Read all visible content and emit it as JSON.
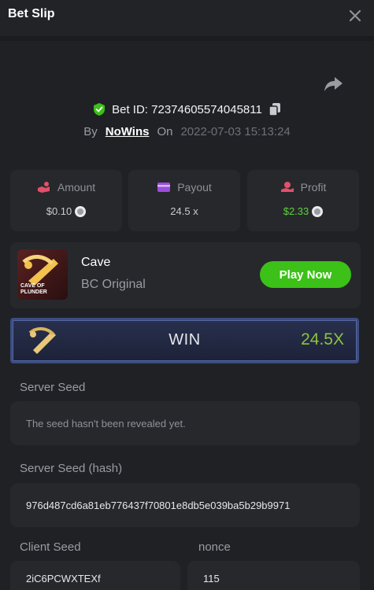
{
  "header": {
    "title": "Bet Slip"
  },
  "bet": {
    "id_text": "Bet ID: 7237460557404581​1",
    "by_label": "By",
    "user": "NoWins",
    "on_label": "On",
    "date": "2022-07-03 15:13:24"
  },
  "stats": [
    {
      "label": "Amount",
      "value": "$0.10",
      "icon": "hand-coins-icon",
      "value_color": "#c9cbd0"
    },
    {
      "label": "Payout",
      "value": "24.5 x",
      "icon": "wallet-icon",
      "value_color": "#c9cbd0"
    },
    {
      "label": "Profit",
      "value": "$2.33",
      "icon": "hand-money-icon",
      "value_color": "#5ed33b"
    }
  ],
  "game": {
    "name": "Cave",
    "subtitle": "BC Original",
    "thumb_text": "CAVE OF PLUNDER",
    "play_label": "Play Now"
  },
  "result": {
    "label": "WIN",
    "multiplier": "24.5X"
  },
  "fields": {
    "server_seed_label": "Server Seed",
    "server_seed_value": "The seed hasn't been revealed yet.",
    "server_hash_label": "Server Seed (hash)",
    "server_hash_value": "976d487cd6a81eb776437f70801e8db5e039ba5b29b9971",
    "client_seed_label": "Client Seed",
    "client_seed_value": "2iC6PCWXTEXf",
    "nonce_label": "nonce",
    "nonce_value": "115"
  },
  "colors": {
    "accent_green": "#3bc117",
    "profit_green": "#5ed33b",
    "multiplier_green": "#8ec33b",
    "verified_green": "#3bc117",
    "banner_border": "#3c4c82"
  }
}
